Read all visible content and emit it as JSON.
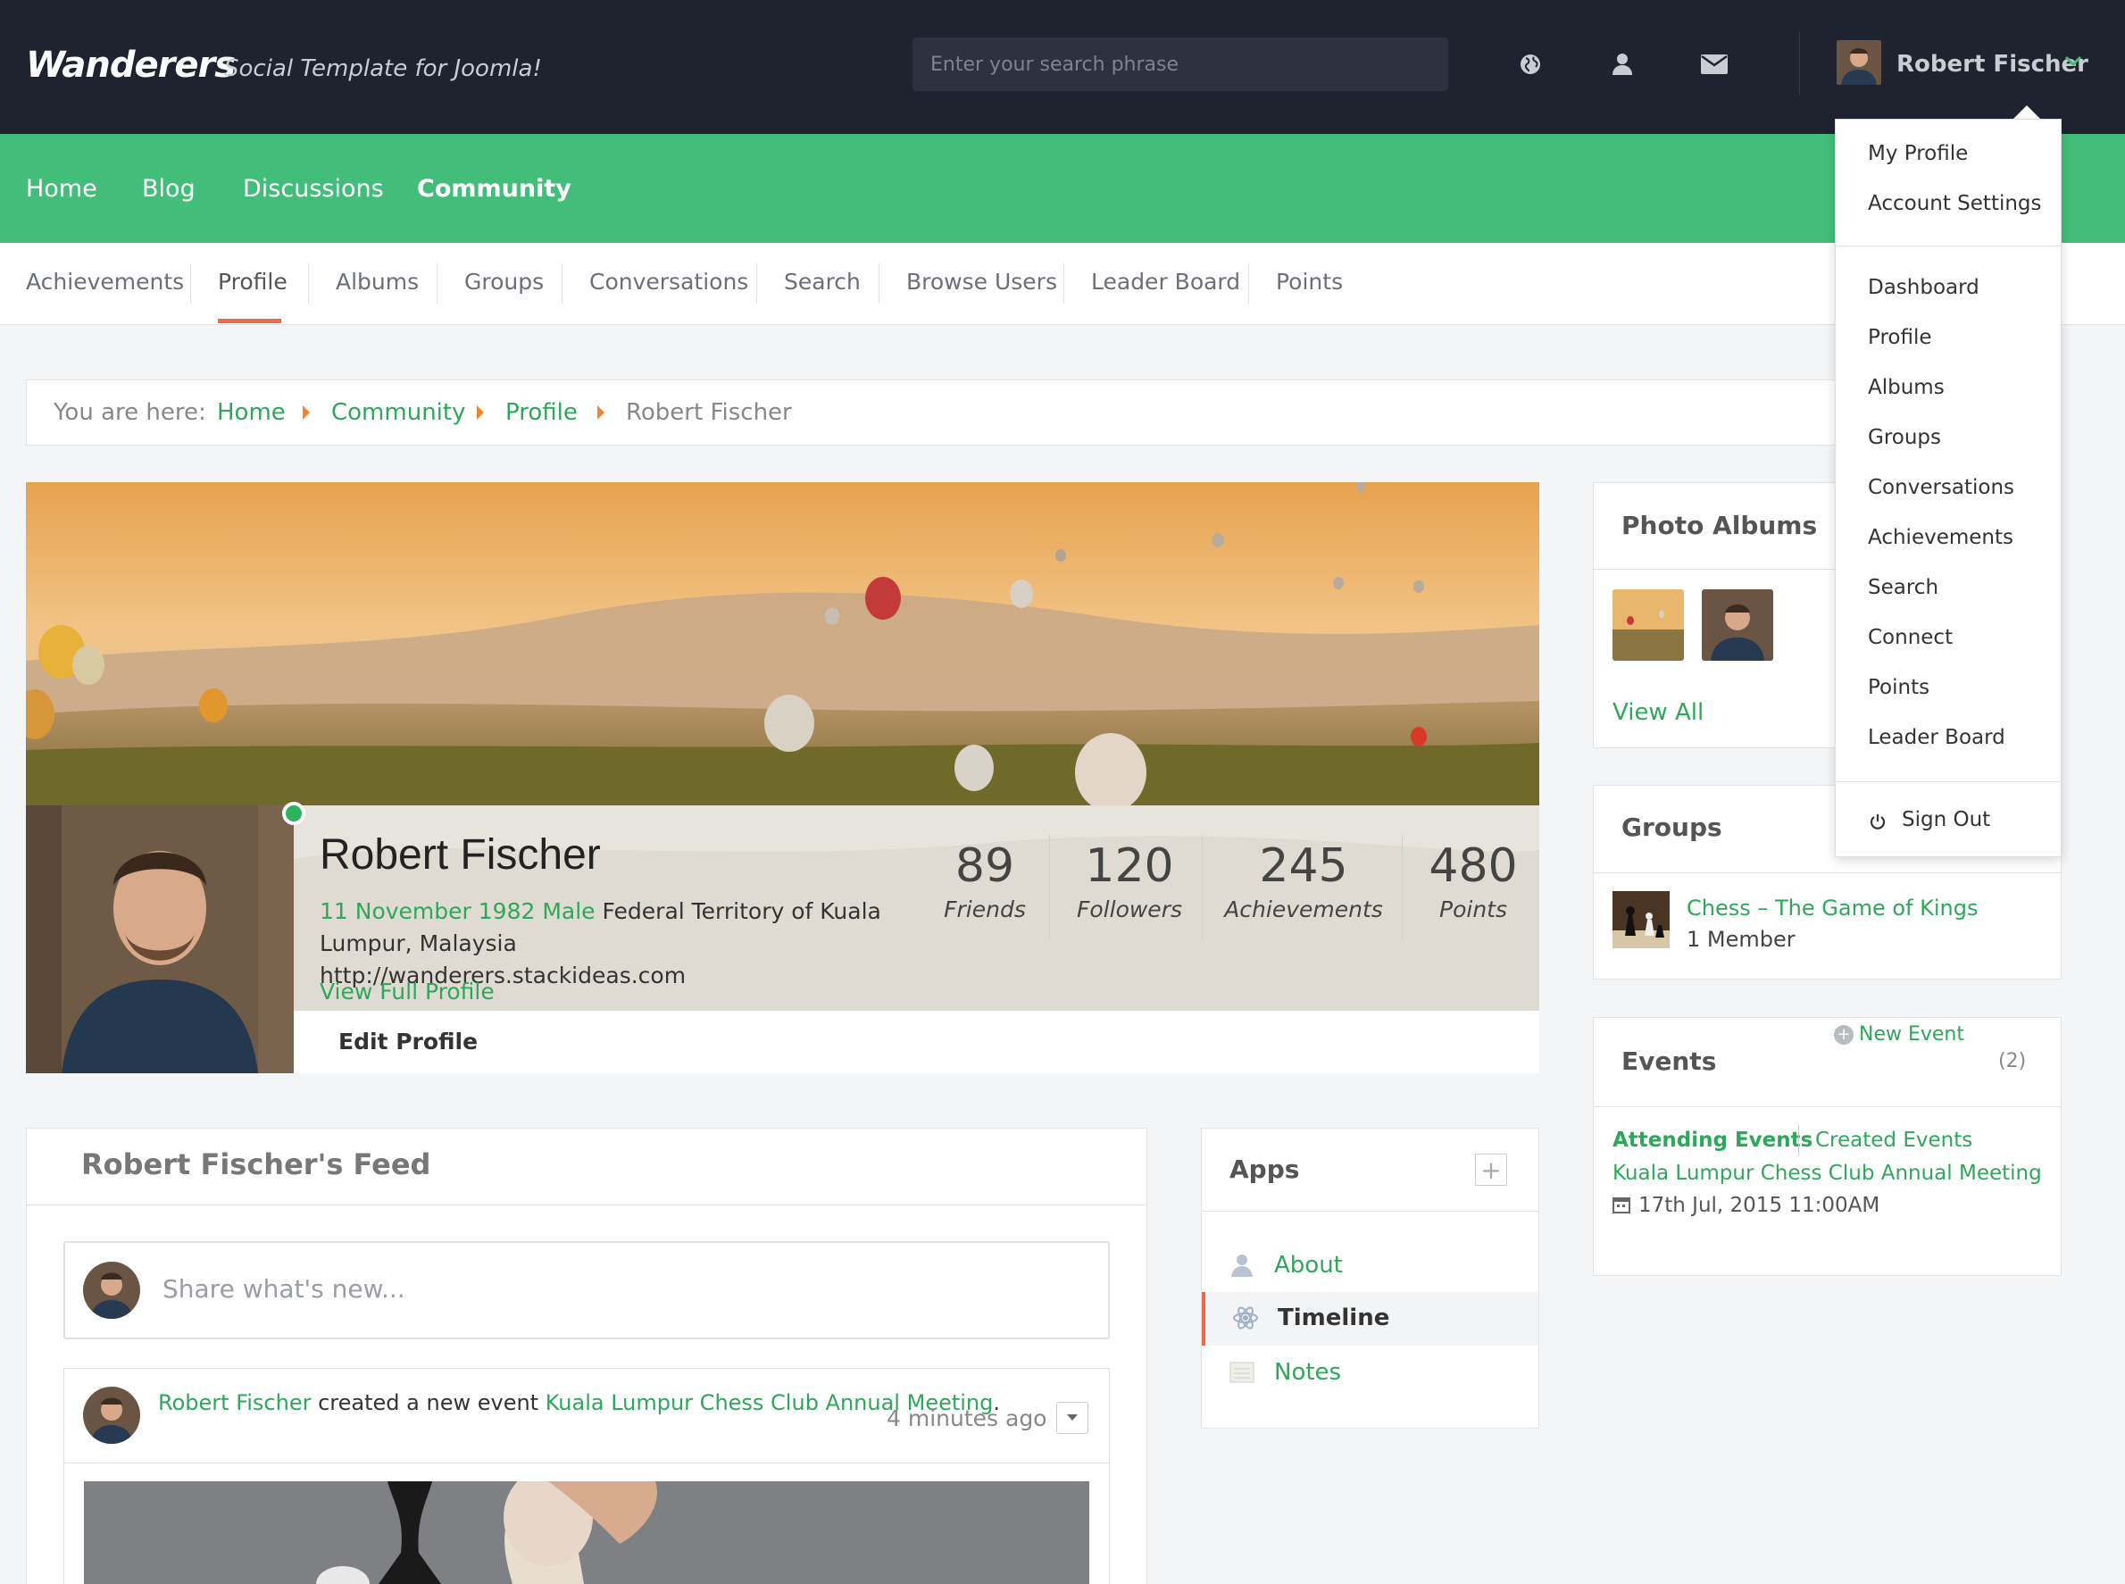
{
  "brand": {
    "name": "Wanderers",
    "tagline": "Social Template for Joomla!"
  },
  "search": {
    "placeholder": "Enter your search phrase"
  },
  "topbar": {
    "icons": [
      "globe-icon",
      "user-icon",
      "mail-icon"
    ],
    "user_name": "Robert Fischer"
  },
  "mainnav": {
    "items": [
      "Home",
      "Blog",
      "Discussions",
      "Community"
    ],
    "active": "Community"
  },
  "subnav": {
    "items": [
      "Achievements",
      "Profile",
      "Albums",
      "Groups",
      "Conversations",
      "Search",
      "Browse Users",
      "Leader Board",
      "Points"
    ],
    "active": "Profile"
  },
  "breadcrumb": {
    "prefix": "You are here:",
    "items": [
      "Home",
      "Community",
      "Profile",
      "Robert Fischer"
    ]
  },
  "profile": {
    "name": "Robert Fischer",
    "birthday": "11 November 1982",
    "gender": "Male",
    "location_line1": "Federal Territory of Kuala",
    "location_line2": "Lumpur, Malaysia",
    "website": "http://wanderers.stackideas.com",
    "view_full": "View Full Profile",
    "edit": "Edit Profile",
    "online": true,
    "stats": [
      {
        "value": "89",
        "label": "Friends"
      },
      {
        "value": "120",
        "label": "Followers"
      },
      {
        "value": "245",
        "label": "Achievements"
      },
      {
        "value": "480",
        "label": "Points"
      }
    ]
  },
  "feed": {
    "title": "Robert Fischer's Feed",
    "share_placeholder": "Share what's new...",
    "post": {
      "actor": "Robert Fischer",
      "action": "created a new event",
      "target": "Kuala Lumpur Chess Club Annual Meeting",
      "suffix": ".",
      "time": "4 minutes ago"
    }
  },
  "apps": {
    "title": "Apps",
    "add": "+",
    "items": [
      "About",
      "Timeline",
      "Notes"
    ],
    "active": "Timeline"
  },
  "albums": {
    "title": "Photo Albums",
    "view_all": "View All"
  },
  "groups": {
    "title": "Groups",
    "item": {
      "name": "Chess – The Game of Kings",
      "members": "1 Member"
    }
  },
  "events": {
    "title": "Events",
    "count": "(2)",
    "new_event": "New Event",
    "tabs": [
      "Attending Events",
      "Created Events"
    ],
    "item": {
      "name": "Kuala Lumpur Chess Club Annual Meeting",
      "date": "17th Jul, 2015 11:00AM"
    }
  },
  "dropdown": {
    "group1": [
      "My Profile",
      "Account Settings"
    ],
    "group2": [
      "Dashboard",
      "Profile",
      "Albums",
      "Groups",
      "Conversations",
      "Achievements",
      "Search",
      "Connect",
      "Points",
      "Leader Board"
    ],
    "signout": "Sign Out"
  },
  "colors": {
    "green": "#43be7a",
    "dark": "#1f2330",
    "accent": "#ee6a4b",
    "link": "#2fa75b"
  }
}
